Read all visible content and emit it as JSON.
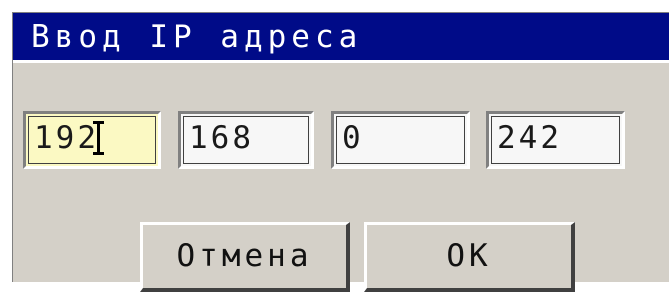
{
  "dialog": {
    "title": "Ввод IP адреса"
  },
  "ip_fields": [
    {
      "value": "192",
      "active": true
    },
    {
      "value": "168",
      "active": false
    },
    {
      "value": "0",
      "active": false
    },
    {
      "value": "242",
      "active": false
    }
  ],
  "buttons": {
    "cancel_label": "Отмена",
    "ok_label": "OK"
  },
  "colors": {
    "titlebar": "#000b88",
    "dialog_bg": "#d4d0c8",
    "active_field": "#fbf9c3"
  }
}
